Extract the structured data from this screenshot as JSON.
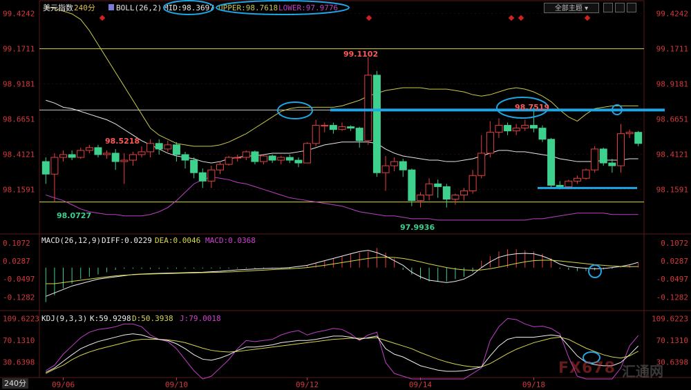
{
  "header": {
    "instrument": "美元指数",
    "period": "240分",
    "boll_label": "BOLL(26,2)",
    "mid": "MID:98.3697",
    "upper": "UPPER:98.7618",
    "lower": "LOWER:97.9776"
  },
  "controls": {
    "select_value": "全部主题"
  },
  "period_switch": "240分",
  "watermark": {
    "brand": "FX678",
    "text": "汇通网"
  },
  "colors": {
    "up": "#e84040",
    "down": "#3ed18e",
    "mid": "#e8e8e8",
    "upper": "#c9c94a",
    "lower": "#c040c8",
    "annotation": "#1ea6e6",
    "axis": "#d23a3a",
    "grid": "#5a1818"
  },
  "chart_data": [
    {
      "type": "candlestick",
      "name": "price",
      "x_ticks": [
        "09/06",
        "09/10",
        "09/12",
        "09/14",
        "09/18"
      ],
      "y_ticks": [
        "99.4242",
        "99.1711",
        "98.9181",
        "98.6651",
        "98.4121",
        "98.1591"
      ],
      "ylim": [
        97.85,
        99.48
      ],
      "indicators": [
        "BOLL(26,2)",
        "MID",
        "UPPER",
        "LOWER"
      ],
      "candles": [
        [
          98.36,
          98.27,
          98.39,
          98.2
        ],
        [
          98.27,
          98.39,
          98.42,
          98.07
        ],
        [
          98.39,
          98.41,
          98.44,
          98.36
        ],
        [
          98.41,
          98.39,
          98.44,
          98.37
        ],
        [
          98.39,
          98.44,
          98.46,
          98.38
        ],
        [
          98.44,
          98.46,
          98.48,
          98.42
        ],
        [
          98.46,
          98.41,
          98.48,
          98.39
        ],
        [
          98.41,
          98.42,
          98.44,
          98.38
        ],
        [
          98.42,
          98.36,
          98.45,
          98.3
        ],
        [
          98.36,
          98.37,
          98.42,
          98.2
        ],
        [
          98.37,
          98.41,
          98.43,
          98.33
        ],
        [
          98.41,
          98.43,
          98.47,
          98.39
        ],
        [
          98.43,
          98.49,
          98.52,
          98.39
        ],
        [
          98.49,
          98.45,
          98.52,
          98.41
        ],
        [
          98.45,
          98.48,
          98.51,
          98.43
        ],
        [
          98.48,
          98.41,
          98.5,
          98.36
        ],
        [
          98.41,
          98.37,
          98.43,
          98.31
        ],
        [
          98.37,
          98.28,
          98.39,
          98.24
        ],
        [
          98.28,
          98.22,
          98.31,
          98.17
        ],
        [
          98.22,
          98.3,
          98.33,
          98.17
        ],
        [
          98.3,
          98.34,
          98.36,
          98.27
        ],
        [
          98.34,
          98.39,
          98.4,
          98.33
        ],
        [
          98.39,
          98.39,
          98.41,
          98.36
        ],
        [
          98.39,
          98.43,
          98.44,
          98.37
        ],
        [
          98.43,
          98.36,
          98.44,
          98.34
        ],
        [
          98.36,
          98.4,
          98.41,
          98.34
        ],
        [
          98.4,
          98.37,
          98.41,
          98.35
        ],
        [
          98.37,
          98.39,
          98.4,
          98.34
        ],
        [
          98.39,
          98.37,
          98.41,
          98.35
        ],
        [
          98.37,
          98.35,
          98.39,
          98.32
        ],
        [
          98.35,
          98.49,
          98.5,
          98.35
        ],
        [
          98.49,
          98.62,
          98.66,
          98.47
        ],
        [
          98.62,
          98.62,
          98.64,
          98.57
        ],
        [
          98.62,
          98.59,
          98.64,
          98.56
        ],
        [
          98.59,
          98.61,
          98.64,
          98.58
        ],
        [
          98.61,
          98.6,
          98.62,
          98.58
        ],
        [
          98.6,
          98.51,
          98.61,
          98.46
        ],
        [
          98.51,
          98.98,
          99.11,
          98.48
        ],
        [
          98.98,
          98.28,
          99.01,
          98.25
        ],
        [
          98.28,
          98.33,
          98.4,
          98.15
        ],
        [
          98.33,
          98.36,
          98.39,
          98.29
        ],
        [
          98.36,
          98.3,
          98.38,
          98.25
        ],
        [
          98.3,
          98.08,
          98.31,
          98.04
        ],
        [
          98.08,
          98.12,
          98.14,
          98.03
        ],
        [
          98.12,
          98.2,
          98.24,
          98.08
        ],
        [
          98.2,
          98.18,
          98.23,
          98.1
        ],
        [
          98.18,
          98.09,
          98.2,
          98.03
        ],
        [
          98.09,
          98.12,
          98.13,
          98.05
        ],
        [
          98.12,
          98.15,
          98.17,
          98.08
        ],
        [
          98.15,
          98.26,
          98.3,
          98.13
        ],
        [
          98.26,
          98.42,
          98.55,
          98.24
        ],
        [
          98.42,
          98.57,
          98.65,
          98.39
        ],
        [
          98.57,
          98.62,
          98.67,
          98.53
        ],
        [
          98.62,
          98.58,
          98.64,
          98.55
        ],
        [
          98.58,
          98.6,
          98.63,
          98.55
        ],
        [
          98.6,
          98.62,
          98.66,
          98.58
        ],
        [
          98.62,
          98.6,
          98.75,
          98.57
        ],
        [
          98.6,
          98.52,
          98.62,
          98.5
        ],
        [
          98.52,
          98.19,
          98.53,
          98.17
        ],
        [
          98.19,
          98.18,
          98.22,
          98.16
        ],
        [
          98.18,
          98.22,
          98.23,
          98.16
        ],
        [
          98.22,
          98.24,
          98.26,
          98.2
        ],
        [
          98.24,
          98.3,
          98.31,
          98.23
        ],
        [
          98.3,
          98.45,
          98.47,
          98.28
        ],
        [
          98.45,
          98.35,
          98.46,
          98.33
        ],
        [
          98.35,
          98.33,
          98.38,
          98.28
        ],
        [
          98.33,
          98.56,
          98.63,
          98.28
        ],
        [
          98.56,
          98.57,
          98.59,
          98.53
        ],
        [
          98.57,
          98.49,
          98.58,
          98.47
        ]
      ],
      "mid_line": [
        98.8,
        98.78,
        98.75,
        98.74,
        98.72,
        98.7,
        98.68,
        98.66,
        98.63,
        98.59,
        98.55,
        98.51,
        98.48,
        98.45,
        98.42,
        98.4,
        98.39,
        98.38,
        98.36,
        98.35,
        98.36,
        98.38,
        98.39,
        98.4,
        98.4,
        98.41,
        98.42,
        98.42,
        98.42,
        98.43,
        98.44,
        98.46,
        98.48,
        98.49,
        98.5,
        98.5,
        98.5,
        98.5,
        98.49,
        98.45,
        98.42,
        98.4,
        98.39,
        98.38,
        98.37,
        98.37,
        98.36,
        98.36,
        98.37,
        98.38,
        98.4,
        98.42,
        98.44,
        98.44,
        98.43,
        98.43,
        98.42,
        98.41,
        98.4,
        98.38,
        98.37,
        98.36,
        98.36,
        98.36,
        98.37,
        98.37,
        98.37,
        98.38,
        98.38
      ],
      "upper_line": [
        99.47,
        99.46,
        99.44,
        99.42,
        99.38,
        99.3,
        99.2,
        99.1,
        99.0,
        98.9,
        98.8,
        98.7,
        98.6,
        98.55,
        98.52,
        98.49,
        98.48,
        98.47,
        98.47,
        98.47,
        98.48,
        98.5,
        98.53,
        98.56,
        98.6,
        98.64,
        98.68,
        98.72,
        98.74,
        98.75,
        98.75,
        98.75,
        98.75,
        98.75,
        98.76,
        98.78,
        98.8,
        98.83,
        98.85,
        98.87,
        98.88,
        98.89,
        98.89,
        98.89,
        98.88,
        98.88,
        98.88,
        98.87,
        98.86,
        98.84,
        98.83,
        98.84,
        98.86,
        98.88,
        98.89,
        98.88,
        98.86,
        98.83,
        98.79,
        98.73,
        98.68,
        98.65,
        98.7,
        98.74,
        98.75,
        98.76,
        98.76,
        98.76,
        98.76
      ],
      "lower_line": [
        98.12,
        98.1,
        98.08,
        98.05,
        98.02,
        98.0,
        97.99,
        97.98,
        97.98,
        97.97,
        97.97,
        97.97,
        97.98,
        98.0,
        98.03,
        98.08,
        98.14,
        98.2,
        98.23,
        98.25,
        98.24,
        98.23,
        98.21,
        98.2,
        98.18,
        98.16,
        98.14,
        98.12,
        98.1,
        98.09,
        98.08,
        98.07,
        98.06,
        98.05,
        98.04,
        98.02,
        98.0,
        97.99,
        97.98,
        97.97,
        97.97,
        97.96,
        97.95,
        97.95,
        97.95,
        97.94,
        97.94,
        97.94,
        97.94,
        97.94,
        97.94,
        97.94,
        97.94,
        97.94,
        97.94,
        97.94,
        97.95,
        97.95,
        97.96,
        97.97,
        97.98,
        97.99,
        97.99,
        97.99,
        97.99,
        97.98,
        97.98,
        97.98,
        97.98
      ],
      "reference_lines": [
        99.17,
        98.73,
        98.07
      ],
      "annotations": {
        "high_1": "98.5218",
        "low_1": "98.0727",
        "high_2": "99.1102",
        "low_2": "97.9936",
        "high_3": "98.7519"
      },
      "resistance_level": 98.73,
      "support_level": 98.17
    },
    {
      "type": "bar",
      "name": "MACD",
      "title": "MACD(26,12,9)",
      "diff_label": "DIFF:0.0229",
      "dea_label": "DEA:0.0046",
      "macd_label": "MACD:0.0368",
      "y_ticks": [
        "0.1072",
        "0.0287",
        "-0.0497",
        "-0.1282"
      ],
      "ylim": [
        -0.175,
        0.125
      ],
      "histogram": [
        -0.15,
        -0.12,
        -0.09,
        -0.07,
        -0.05,
        -0.04,
        -0.03,
        -0.02,
        -0.01,
        -0.005,
        -0.005,
        -0.005,
        -0.006,
        -0.006,
        -0.005,
        -0.005,
        -0.004,
        -0.004,
        -0.004,
        -0.004,
        -0.004,
        -0.004,
        -0.004,
        -0.004,
        -0.004,
        -0.004,
        -0.004,
        -0.004,
        -0.004,
        -0.004,
        0.01,
        0.02,
        0.03,
        0.04,
        0.05,
        0.06,
        0.065,
        0.07,
        0.085,
        0.065,
        0.04,
        -0.01,
        -0.03,
        -0.05,
        -0.06,
        -0.06,
        -0.06,
        -0.05,
        -0.04,
        -0.02,
        0.03,
        0.05,
        0.07,
        0.08,
        0.08,
        0.075,
        0.07,
        0.06,
        0.04,
        -0.005,
        -0.01,
        -0.015,
        -0.015,
        -0.012,
        -0.008,
        -0.005,
        0.005,
        0.01,
        0.02
      ],
      "diff_line": [
        -0.125,
        -0.11,
        -0.095,
        -0.08,
        -0.07,
        -0.06,
        -0.05,
        -0.045,
        -0.04,
        -0.035,
        -0.03,
        -0.028,
        -0.026,
        -0.025,
        -0.024,
        -0.023,
        -0.022,
        -0.021,
        -0.02,
        -0.018,
        -0.016,
        -0.013,
        -0.01,
        -0.008,
        -0.006,
        -0.004,
        -0.003,
        -0.002,
        0.0,
        0.005,
        0.01,
        0.02,
        0.03,
        0.04,
        0.05,
        0.06,
        0.07,
        0.075,
        0.065,
        0.05,
        0.03,
        0.01,
        -0.02,
        -0.04,
        -0.055,
        -0.06,
        -0.065,
        -0.06,
        -0.05,
        -0.03,
        0.0,
        0.025,
        0.045,
        0.055,
        0.06,
        0.062,
        0.06,
        0.05,
        0.035,
        0.015,
        0.005,
        0.0,
        -0.003,
        -0.005,
        -0.004,
        0.0,
        0.005,
        0.012,
        0.0229
      ],
      "dea_line": [
        -0.07,
        -0.07,
        -0.065,
        -0.06,
        -0.055,
        -0.05,
        -0.045,
        -0.04,
        -0.036,
        -0.033,
        -0.031,
        -0.029,
        -0.028,
        -0.027,
        -0.026,
        -0.025,
        -0.024,
        -0.023,
        -0.022,
        -0.021,
        -0.02,
        -0.019,
        -0.017,
        -0.015,
        -0.013,
        -0.011,
        -0.009,
        -0.007,
        -0.005,
        -0.003,
        0.0,
        0.005,
        0.01,
        0.016,
        0.022,
        0.028,
        0.034,
        0.04,
        0.044,
        0.045,
        0.044,
        0.04,
        0.033,
        0.025,
        0.016,
        0.008,
        0.0,
        -0.006,
        -0.01,
        -0.012,
        -0.01,
        -0.005,
        0.002,
        0.01,
        0.018,
        0.025,
        0.03,
        0.032,
        0.032,
        0.029,
        0.025,
        0.021,
        0.017,
        0.013,
        0.01,
        0.007,
        0.005,
        0.004,
        0.0046
      ]
    },
    {
      "type": "line",
      "name": "KDJ",
      "title": "KDJ(9,3,3)",
      "k_label": "K:59.9298",
      "d_label": "D:50.3938",
      "j_label": "J:79.0018",
      "y_ticks": [
        "109.6223",
        "70.1310",
        "30.6398"
      ],
      "ylim": [
        5,
        118
      ],
      "k_line": [
        12,
        20,
        32,
        44,
        55,
        62,
        68,
        72,
        76,
        80,
        82,
        80,
        75,
        72,
        70,
        64,
        55,
        44,
        36,
        34,
        38,
        44,
        52,
        58,
        58,
        60,
        62,
        66,
        68,
        70,
        70,
        72,
        75,
        78,
        78,
        76,
        72,
        75,
        78,
        55,
        45,
        40,
        32,
        24,
        20,
        16,
        14,
        14,
        15,
        18,
        22,
        42,
        60,
        72,
        76,
        76,
        76,
        78,
        80,
        78,
        60,
        42,
        30,
        26,
        24,
        24,
        30,
        44,
        59.93
      ],
      "d_line": [
        10,
        18,
        25,
        35,
        43,
        49,
        54,
        58,
        62,
        66,
        70,
        72,
        72,
        72,
        71,
        69,
        66,
        61,
        56,
        52,
        50,
        49,
        50,
        52,
        54,
        56,
        58,
        60,
        62,
        64,
        66,
        68,
        70,
        72,
        73,
        74,
        74,
        74,
        75,
        70,
        65,
        60,
        55,
        48,
        42,
        36,
        31,
        27,
        24,
        22,
        22,
        28,
        37,
        46,
        54,
        60,
        66,
        70,
        74,
        76,
        72,
        64,
        56,
        50,
        44,
        40,
        38,
        42,
        50.39
      ],
      "j_line": [
        15,
        25,
        45,
        60,
        75,
        85,
        90,
        92,
        95,
        100,
        100,
        95,
        80,
        72,
        68,
        55,
        35,
        15,
        0,
        5,
        20,
        35,
        55,
        70,
        68,
        70,
        72,
        80,
        85,
        88,
        80,
        85,
        88,
        92,
        90,
        82,
        70,
        80,
        85,
        30,
        10,
        5,
        0,
        0,
        0,
        0,
        0,
        0,
        0,
        10,
        20,
        70,
        95,
        110,
        108,
        100,
        95,
        96,
        92,
        82,
        40,
        5,
        0,
        0,
        0,
        0,
        20,
        60,
        79.0
      ]
    }
  ]
}
